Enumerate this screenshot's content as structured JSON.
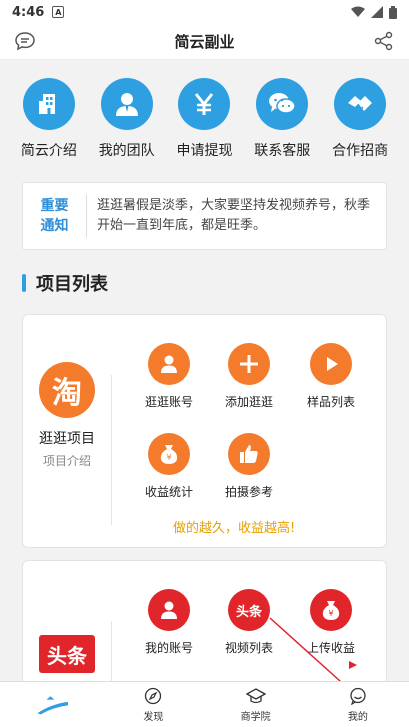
{
  "status": {
    "time": "4:46",
    "notif_glyph": "A"
  },
  "header": {
    "title": "简云副业"
  },
  "menu": [
    {
      "label": "简云介绍",
      "icon": "building-icon"
    },
    {
      "label": "我的团队",
      "icon": "person-icon"
    },
    {
      "label": "申请提现",
      "icon": "yen-icon"
    },
    {
      "label": "联系客服",
      "icon": "wechat-icon"
    },
    {
      "label": "合作招商",
      "icon": "handshake-icon"
    }
  ],
  "notice": {
    "tag_line1": "重要",
    "tag_line2": "通知",
    "text": "逛逛暑假是淡季，大家要坚持发视频养号，秋季开始一直到年底，都是旺季。"
  },
  "section": {
    "title": "项目列表"
  },
  "project1": {
    "logo_char": "淘",
    "name": "逛逛项目",
    "sub": "项目介绍",
    "items": [
      {
        "label": "逛逛账号",
        "icon": "user-icon"
      },
      {
        "label": "添加逛逛",
        "icon": "plus-icon"
      },
      {
        "label": "样品列表",
        "icon": "play-icon"
      },
      {
        "label": "收益统计",
        "icon": "money-bag-icon"
      },
      {
        "label": "拍摄参考",
        "icon": "thumbs-up-icon"
      }
    ],
    "slogan": "做的越久，收益越高!"
  },
  "project2": {
    "logo_text": "头条",
    "items": [
      {
        "label": "我的账号",
        "icon": "user-icon"
      },
      {
        "label": "视频列表",
        "icon": "toutiao-icon",
        "icon_text": "头条"
      },
      {
        "label": "上传收益",
        "icon": "money-bag-icon"
      }
    ]
  },
  "tabs": [
    {
      "label": "",
      "icon": "home-swoosh-icon"
    },
    {
      "label": "发现",
      "icon": "compass-icon"
    },
    {
      "label": "商学院",
      "icon": "graduation-cap-icon"
    },
    {
      "label": "我的",
      "icon": "chat-face-icon"
    }
  ],
  "colors": {
    "accent": "#2e9fe0",
    "orange": "#f47a2c",
    "red": "#e0262a",
    "slogan": "#e8a000"
  }
}
